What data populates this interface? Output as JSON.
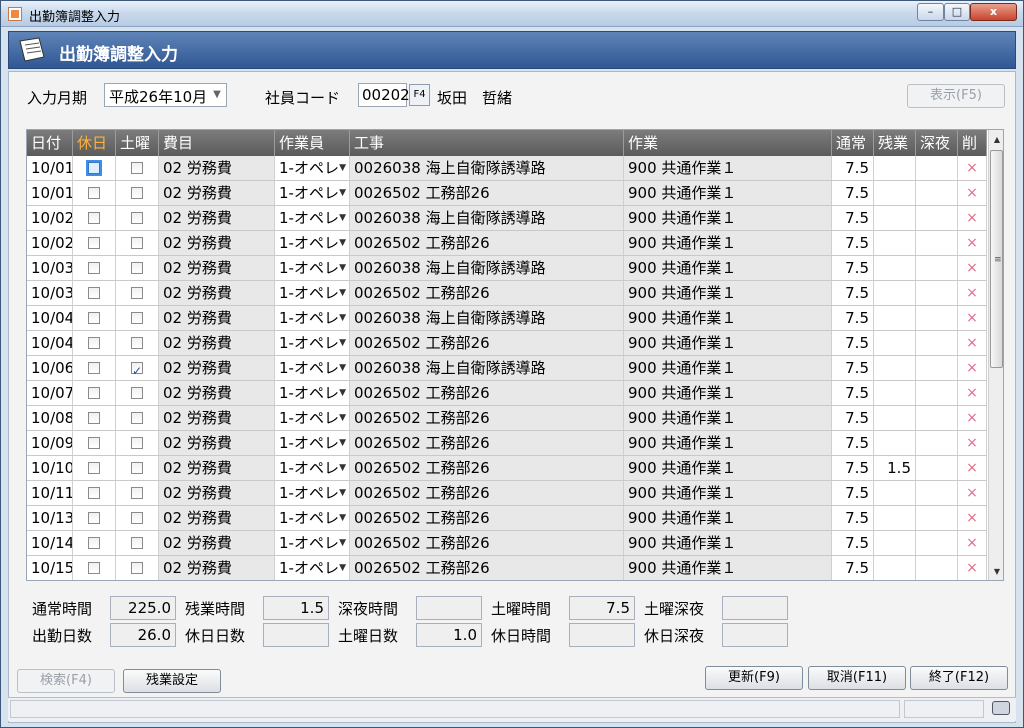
{
  "window": {
    "title": "出勤簿調整入力",
    "min_label": "–",
    "max_label": "□",
    "close_label": "x"
  },
  "header": {
    "title": "出勤簿調整入力"
  },
  "filter": {
    "month_label": "入力月期",
    "month_value": "平成26年10月",
    "employee_label": "社員コード",
    "employee_code": "00202",
    "employee_key": "F4",
    "employee_name": "坂田　哲緒",
    "show_button": "表示(F5)"
  },
  "grid": {
    "columns": [
      "日付",
      "休日",
      "土曜",
      "費目",
      "作業員",
      "工事",
      "作業",
      "通常",
      "残業",
      "深夜",
      "削"
    ],
    "rows": [
      {
        "date": "10/01",
        "holiday": false,
        "saturday": false,
        "expense": "02 労務費",
        "worker": "1-オペレ",
        "project": "0026038 海上自衛隊誘導路",
        "task": "900 共通作業１",
        "normal": "7.5",
        "overtime": "",
        "night": "",
        "focus": true
      },
      {
        "date": "10/01",
        "holiday": false,
        "saturday": false,
        "expense": "02 労務費",
        "worker": "1-オペレ",
        "project": "0026502 工務部26",
        "task": "900 共通作業１",
        "normal": "7.5",
        "overtime": "",
        "night": ""
      },
      {
        "date": "10/02",
        "holiday": false,
        "saturday": false,
        "expense": "02 労務費",
        "worker": "1-オペレ",
        "project": "0026038 海上自衛隊誘導路",
        "task": "900 共通作業１",
        "normal": "7.5",
        "overtime": "",
        "night": ""
      },
      {
        "date": "10/02",
        "holiday": false,
        "saturday": false,
        "expense": "02 労務費",
        "worker": "1-オペレ",
        "project": "0026502 工務部26",
        "task": "900 共通作業１",
        "normal": "7.5",
        "overtime": "",
        "night": ""
      },
      {
        "date": "10/03",
        "holiday": false,
        "saturday": false,
        "expense": "02 労務費",
        "worker": "1-オペレ",
        "project": "0026038 海上自衛隊誘導路",
        "task": "900 共通作業１",
        "normal": "7.5",
        "overtime": "",
        "night": ""
      },
      {
        "date": "10/03",
        "holiday": false,
        "saturday": false,
        "expense": "02 労務費",
        "worker": "1-オペレ",
        "project": "0026502 工務部26",
        "task": "900 共通作業１",
        "normal": "7.5",
        "overtime": "",
        "night": ""
      },
      {
        "date": "10/04",
        "holiday": false,
        "saturday": false,
        "expense": "02 労務費",
        "worker": "1-オペレ",
        "project": "0026038 海上自衛隊誘導路",
        "task": "900 共通作業１",
        "normal": "7.5",
        "overtime": "",
        "night": ""
      },
      {
        "date": "10/04",
        "holiday": false,
        "saturday": false,
        "expense": "02 労務費",
        "worker": "1-オペレ",
        "project": "0026502 工務部26",
        "task": "900 共通作業１",
        "normal": "7.5",
        "overtime": "",
        "night": ""
      },
      {
        "date": "10/06",
        "holiday": false,
        "saturday": true,
        "expense": "02 労務費",
        "worker": "1-オペレ",
        "project": "0026038 海上自衛隊誘導路",
        "task": "900 共通作業１",
        "normal": "7.5",
        "overtime": "",
        "night": ""
      },
      {
        "date": "10/07",
        "holiday": false,
        "saturday": false,
        "expense": "02 労務費",
        "worker": "1-オペレ",
        "project": "0026502 工務部26",
        "task": "900 共通作業１",
        "normal": "7.5",
        "overtime": "",
        "night": ""
      },
      {
        "date": "10/08",
        "holiday": false,
        "saturday": false,
        "expense": "02 労務費",
        "worker": "1-オペレ",
        "project": "0026502 工務部26",
        "task": "900 共通作業１",
        "normal": "7.5",
        "overtime": "",
        "night": ""
      },
      {
        "date": "10/09",
        "holiday": false,
        "saturday": false,
        "expense": "02 労務費",
        "worker": "1-オペレ",
        "project": "0026502 工務部26",
        "task": "900 共通作業１",
        "normal": "7.5",
        "overtime": "",
        "night": ""
      },
      {
        "date": "10/10",
        "holiday": false,
        "saturday": false,
        "expense": "02 労務費",
        "worker": "1-オペレ",
        "project": "0026502 工務部26",
        "task": "900 共通作業１",
        "normal": "7.5",
        "overtime": "1.5",
        "night": ""
      },
      {
        "date": "10/11",
        "holiday": false,
        "saturday": false,
        "expense": "02 労務費",
        "worker": "1-オペレ",
        "project": "0026502 工務部26",
        "task": "900 共通作業１",
        "normal": "7.5",
        "overtime": "",
        "night": ""
      },
      {
        "date": "10/13",
        "holiday": false,
        "saturday": false,
        "expense": "02 労務費",
        "worker": "1-オペレ",
        "project": "0026502 工務部26",
        "task": "900 共通作業１",
        "normal": "7.5",
        "overtime": "",
        "night": ""
      },
      {
        "date": "10/14",
        "holiday": false,
        "saturday": false,
        "expense": "02 労務費",
        "worker": "1-オペレ",
        "project": "0026502 工務部26",
        "task": "900 共通作業１",
        "normal": "7.5",
        "overtime": "",
        "night": ""
      },
      {
        "date": "10/15",
        "holiday": false,
        "saturday": false,
        "expense": "02 労務費",
        "worker": "1-オペレ",
        "project": "0026502 工務部26",
        "task": "900 共通作業１",
        "normal": "7.5",
        "overtime": "",
        "night": ""
      }
    ],
    "delete_glyph": "×"
  },
  "summary": {
    "row1": [
      {
        "label": "通常時間",
        "value": "225.0"
      },
      {
        "label": "残業時間",
        "value": "1.5"
      },
      {
        "label": "深夜時間",
        "value": ""
      },
      {
        "label": "土曜時間",
        "value": "7.5"
      },
      {
        "label": "土曜深夜",
        "value": ""
      }
    ],
    "row2": [
      {
        "label": "出勤日数",
        "value": "26.0"
      },
      {
        "label": "休日日数",
        "value": ""
      },
      {
        "label": "土曜日数",
        "value": "1.0"
      },
      {
        "label": "休日時間",
        "value": ""
      },
      {
        "label": "休日深夜",
        "value": ""
      }
    ]
  },
  "buttons": {
    "search": "検索(F4)",
    "overtime_settings": "残業設定",
    "update": "更新(F9)",
    "cancel": "取消(F11)",
    "exit": "終了(F12)"
  },
  "colors": {
    "header_bg": "#3a62a0",
    "holiday_header": "#ffb13b",
    "delete_mark": "#e46b8a"
  }
}
